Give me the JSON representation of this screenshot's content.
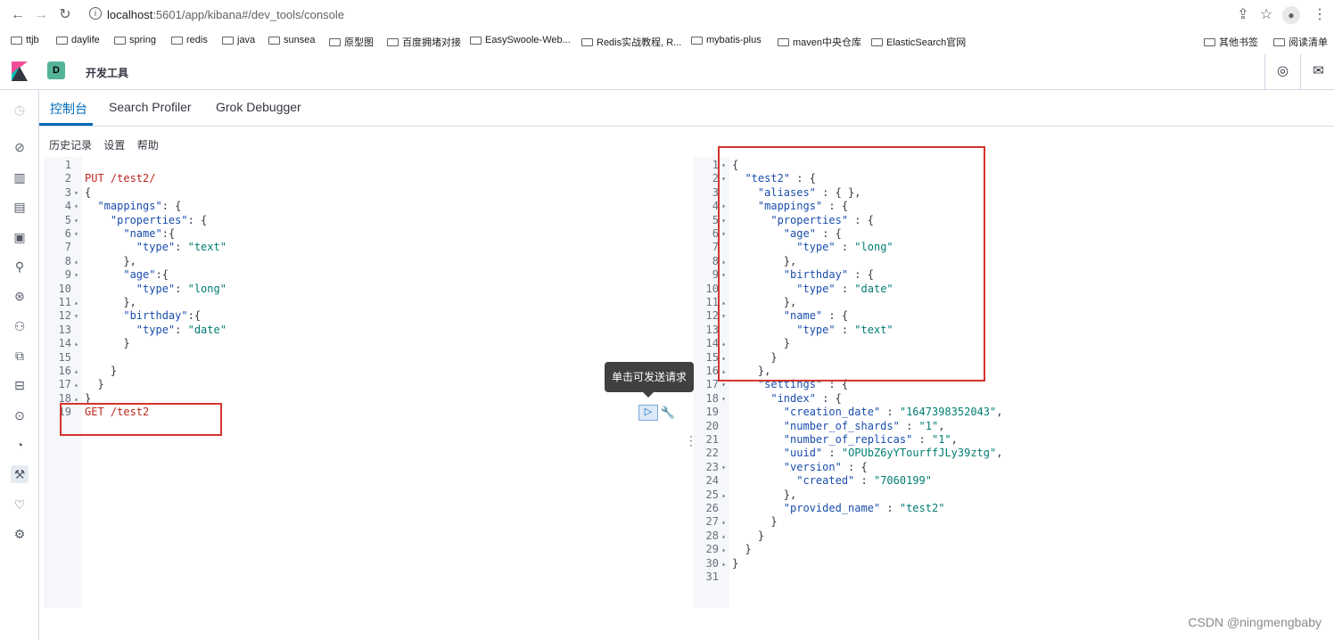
{
  "browser": {
    "url_host": "localhost",
    "url_path": ":5601/app/kibana#/dev_tools/console",
    "bookmarks": [
      "ttjb",
      "daylife",
      "spring",
      "redis",
      "java",
      "sunsea",
      "原型图",
      "百度拥堵对接",
      "EasySwoole-Web...",
      "Redis实战教程, R...",
      "mybatis-plus",
      "maven中央仓库",
      "ElasticSearch官网"
    ],
    "bookmarks_right": [
      "其他书签",
      "阅读清单"
    ]
  },
  "header": {
    "space_letter": "D",
    "app_title": "开发工具"
  },
  "tabs": [
    "控制台",
    "Search Profiler",
    "Grok Debugger"
  ],
  "submenu": [
    "历史记录",
    "设置",
    "帮助"
  ],
  "tooltip": "单击可发送请求",
  "request_editor": {
    "lines": [
      {
        "n": "1",
        "fold": "",
        "text": ""
      },
      {
        "n": "2",
        "fold": "",
        "text": "PUT /test2/"
      },
      {
        "n": "3",
        "fold": "▾",
        "text": "{"
      },
      {
        "n": "4",
        "fold": "▾",
        "text": "  \"mappings\": {"
      },
      {
        "n": "5",
        "fold": "▾",
        "text": "    \"properties\": {"
      },
      {
        "n": "6",
        "fold": "▾",
        "text": "      \"name\":{"
      },
      {
        "n": "7",
        "fold": "",
        "text": "        \"type\": \"text\""
      },
      {
        "n": "8",
        "fold": "▴",
        "text": "      },"
      },
      {
        "n": "9",
        "fold": "▾",
        "text": "      \"age\":{"
      },
      {
        "n": "10",
        "fold": "",
        "text": "        \"type\": \"long\""
      },
      {
        "n": "11",
        "fold": "▴",
        "text": "      },"
      },
      {
        "n": "12",
        "fold": "▾",
        "text": "      \"birthday\":{"
      },
      {
        "n": "13",
        "fold": "",
        "text": "        \"type\": \"date\""
      },
      {
        "n": "14",
        "fold": "▴",
        "text": "      }"
      },
      {
        "n": "15",
        "fold": "",
        "text": ""
      },
      {
        "n": "16",
        "fold": "▴",
        "text": "    }"
      },
      {
        "n": "17",
        "fold": "▴",
        "text": "  }"
      },
      {
        "n": "18",
        "fold": "▴",
        "text": "}"
      },
      {
        "n": "19",
        "fold": "",
        "text": "GET /test2"
      }
    ]
  },
  "response_editor": {
    "lines": [
      {
        "n": "1",
        "fold": "▾",
        "text": "{"
      },
      {
        "n": "2",
        "fold": "▾",
        "text": "  \"test2\" : {"
      },
      {
        "n": "3",
        "fold": "",
        "text": "    \"aliases\" : { },"
      },
      {
        "n": "4",
        "fold": "▾",
        "text": "    \"mappings\" : {"
      },
      {
        "n": "5",
        "fold": "▾",
        "text": "      \"properties\" : {"
      },
      {
        "n": "6",
        "fold": "▾",
        "text": "        \"age\" : {"
      },
      {
        "n": "7",
        "fold": "",
        "text": "          \"type\" : \"long\""
      },
      {
        "n": "8",
        "fold": "▴",
        "text": "        },"
      },
      {
        "n": "9",
        "fold": "▾",
        "text": "        \"birthday\" : {"
      },
      {
        "n": "10",
        "fold": "",
        "text": "          \"type\" : \"date\""
      },
      {
        "n": "11",
        "fold": "▴",
        "text": "        },"
      },
      {
        "n": "12",
        "fold": "▾",
        "text": "        \"name\" : {"
      },
      {
        "n": "13",
        "fold": "",
        "text": "          \"type\" : \"text\""
      },
      {
        "n": "14",
        "fold": "▴",
        "text": "        }"
      },
      {
        "n": "15",
        "fold": "▴",
        "text": "      }"
      },
      {
        "n": "16",
        "fold": "▴",
        "text": "    },"
      },
      {
        "n": "17",
        "fold": "▾",
        "text": "    \"settings\" : {"
      },
      {
        "n": "18",
        "fold": "▾",
        "text": "      \"index\" : {"
      },
      {
        "n": "19",
        "fold": "",
        "text": "        \"creation_date\" : \"1647398352043\","
      },
      {
        "n": "20",
        "fold": "",
        "text": "        \"number_of_shards\" : \"1\","
      },
      {
        "n": "21",
        "fold": "",
        "text": "        \"number_of_replicas\" : \"1\","
      },
      {
        "n": "22",
        "fold": "",
        "text": "        \"uuid\" : \"OPUbZ6yYTourffJLy39ztg\","
      },
      {
        "n": "23",
        "fold": "▾",
        "text": "        \"version\" : {"
      },
      {
        "n": "24",
        "fold": "",
        "text": "          \"created\" : \"7060199\""
      },
      {
        "n": "25",
        "fold": "▴",
        "text": "        },"
      },
      {
        "n": "26",
        "fold": "",
        "text": "        \"provided_name\" : \"test2\""
      },
      {
        "n": "27",
        "fold": "▴",
        "text": "      }"
      },
      {
        "n": "28",
        "fold": "▴",
        "text": "    }"
      },
      {
        "n": "29",
        "fold": "▴",
        "text": "  }"
      },
      {
        "n": "30",
        "fold": "▴",
        "text": "}"
      },
      {
        "n": "31",
        "fold": "",
        "text": ""
      }
    ]
  },
  "watermark": "CSDN @ningmengbaby",
  "icons": {
    "nav": [
      "clock-icon",
      "compass-icon",
      "visualize-icon",
      "dashboard-icon",
      "canvas-icon",
      "maps-icon",
      "ml-icon",
      "graph-icon",
      "apm-icon",
      "uptime-icon",
      "siem-icon",
      "monitoring-icon",
      "devtools-icon",
      "heartbeat-icon",
      "gear-icon"
    ]
  }
}
